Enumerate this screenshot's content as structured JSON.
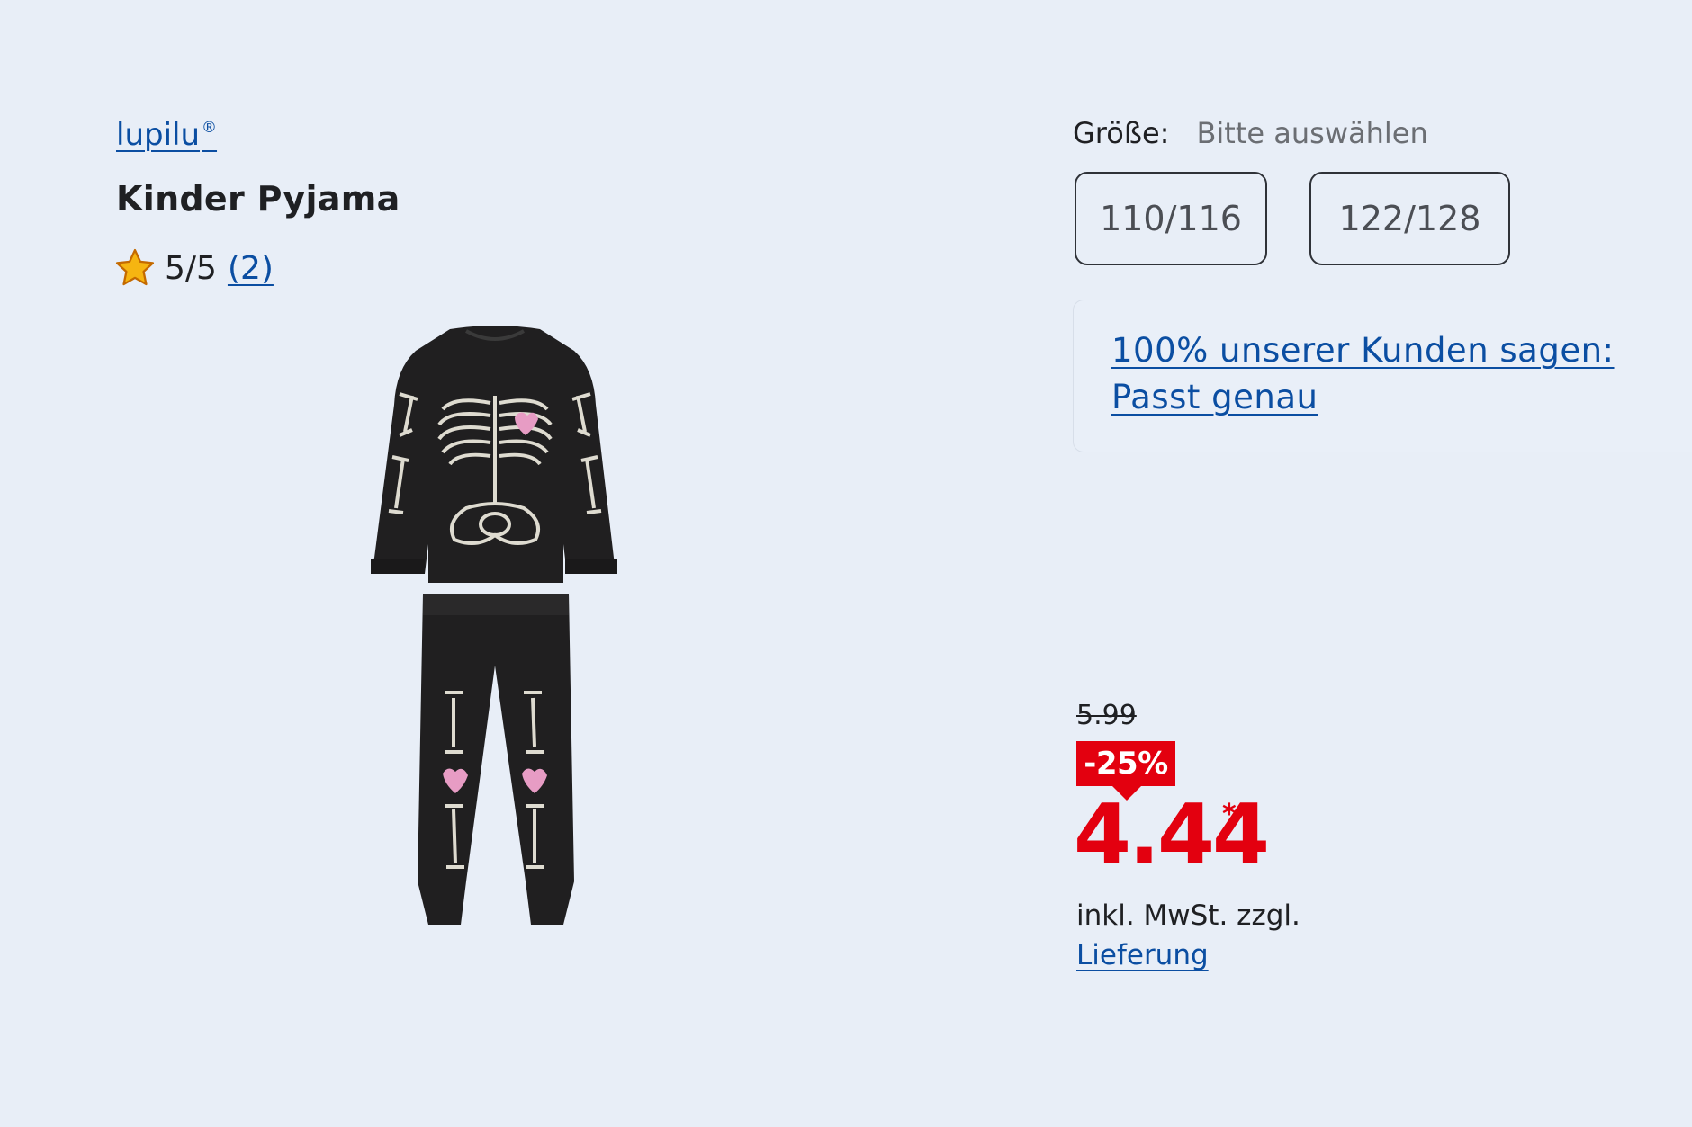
{
  "product": {
    "brand": "lupilu",
    "brand_mark": "®",
    "title": "Kinder Pyjama",
    "rating": {
      "score_text": "5/5",
      "count_text": "(2)",
      "stars_value": 5,
      "star_icon": "star-icon"
    }
  },
  "size": {
    "label": "Größe:",
    "placeholder": "Bitte auswählen",
    "options": [
      "110/116",
      "122/128"
    ]
  },
  "fit": {
    "link_text": "100% unserer Kunden sagen: Passt genau"
  },
  "price": {
    "old": "5.99",
    "discount": "-25%",
    "current": "4.44",
    "asterisk": "*",
    "tax_note": "inkl. MwSt. zzgl.",
    "delivery_link": "Lieferung"
  },
  "colors": {
    "background": "#e8eef7",
    "link": "#0b4ea2",
    "accent_red": "#e3000f",
    "text": "#1f2023"
  }
}
